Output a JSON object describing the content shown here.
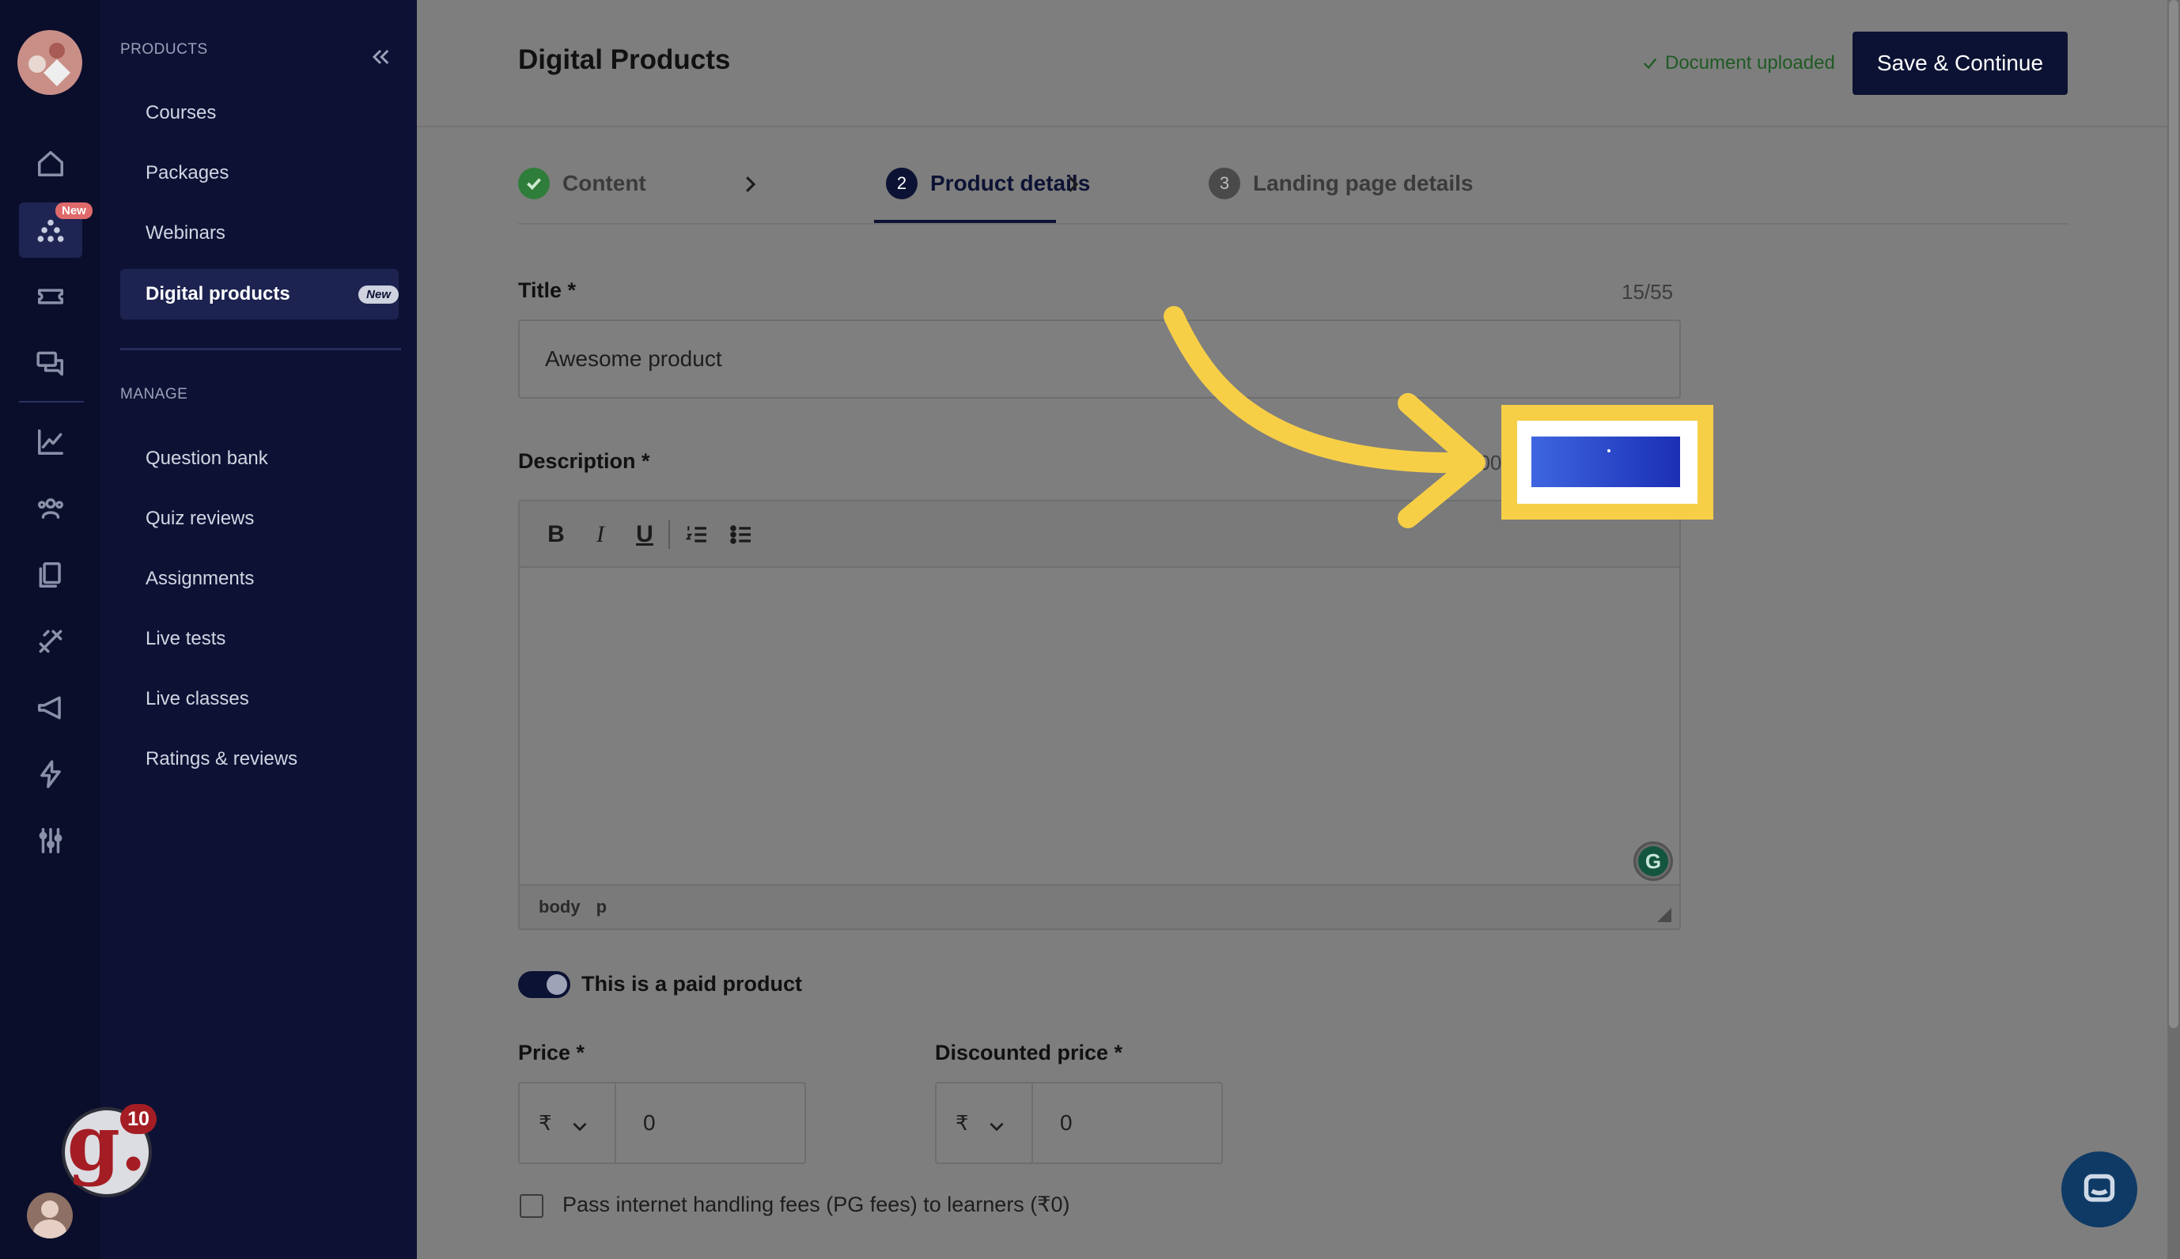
{
  "rail": {
    "new_badge": "New",
    "icons": [
      "home-icon",
      "products-icon",
      "ticket-icon",
      "chat-icon",
      "analytics-icon",
      "users-icon",
      "documents-icon",
      "design-icon",
      "megaphone-icon",
      "lightning-icon",
      "settings-sliders-icon"
    ],
    "notification_count": "10",
    "brand_letter": "g."
  },
  "sidebar": {
    "products_heading": "PRODUCTS",
    "products": [
      {
        "label": "Courses"
      },
      {
        "label": "Packages"
      },
      {
        "label": "Webinars"
      },
      {
        "label": "Digital products",
        "badge": "New",
        "active": true
      }
    ],
    "manage_heading": "MANAGE",
    "manage": [
      {
        "label": "Question bank"
      },
      {
        "label": "Quiz reviews"
      },
      {
        "label": "Assignments"
      },
      {
        "label": "Live tests"
      },
      {
        "label": "Live classes"
      },
      {
        "label": "Ratings & reviews"
      }
    ]
  },
  "header": {
    "title": "Digital Products",
    "status": "Document uploaded",
    "save_label": "Save & Continue"
  },
  "steps": [
    {
      "label": "Content",
      "state": "done"
    },
    {
      "number": "2",
      "label": "Product details",
      "state": "current"
    },
    {
      "number": "3",
      "label": "Landing page details",
      "state": "upcoming"
    }
  ],
  "form": {
    "title_label": "Title *",
    "title_counter": "15/55",
    "title_value": "Awesome product",
    "description_label": "Description *",
    "description_counter_partial": "100",
    "editor_status": [
      "body",
      "p"
    ],
    "grammarly_letter": "G",
    "paid_toggle_label": "This is a paid product",
    "paid": true,
    "price_label": "Price *",
    "price_currency": "₹",
    "price_value": "0",
    "discount_label": "Discounted price *",
    "discount_currency": "₹",
    "discount_value": "0",
    "pg_fees_label": "Pass internet handling fees (PG fees) to learners (₹0)"
  },
  "colors": {
    "highlight": "#f7cf47",
    "primary": "#0c1233",
    "success": "#2f7d3a"
  }
}
